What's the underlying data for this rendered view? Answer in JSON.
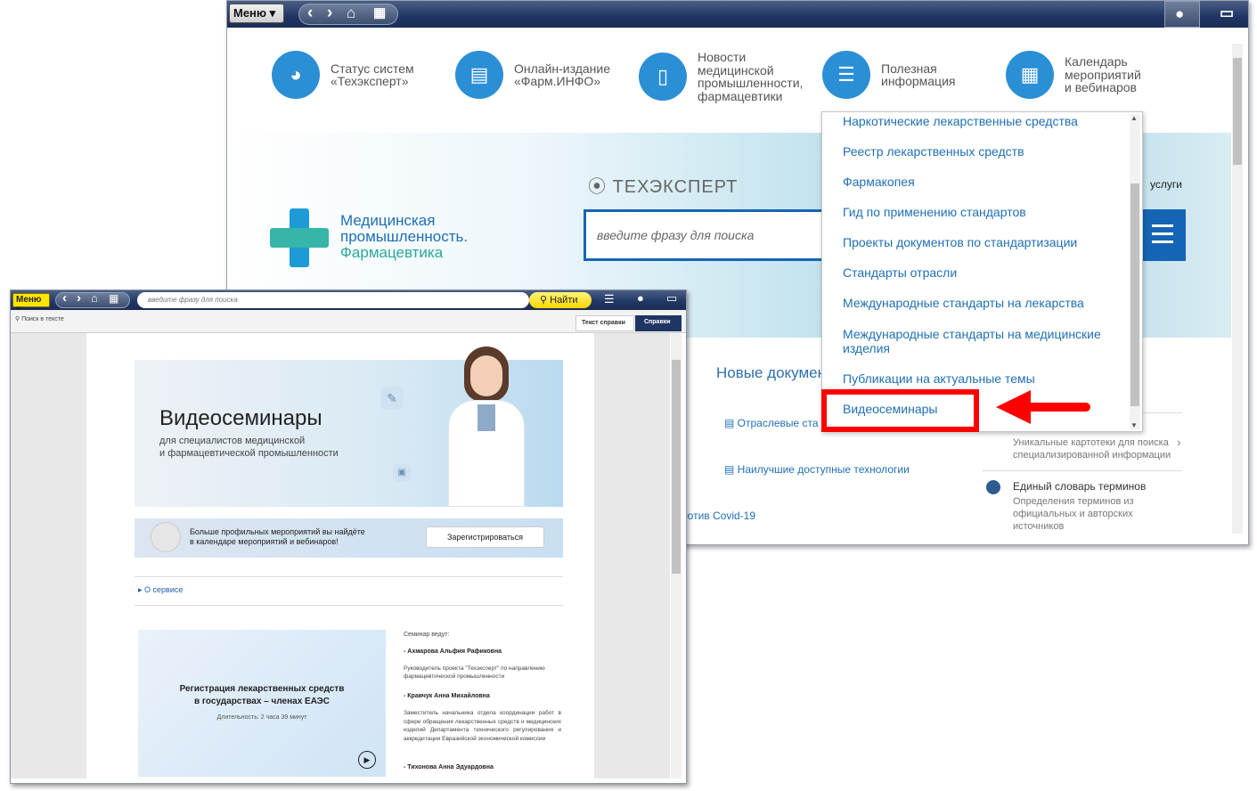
{
  "main_window": {
    "menu_label": "Меню",
    "topics": [
      {
        "icon": "rs-logo-icon",
        "label": "Статус систем\n«Техэксперт»"
      },
      {
        "icon": "monitor-icon",
        "label": "Онлайн-издание\n«Фарм.ИНФО»"
      },
      {
        "icon": "document-icon",
        "label": "Новости\nмедицинской\nпромышленности,\nфармацевтики"
      },
      {
        "icon": "info-document-icon",
        "label": "Полезная\nинформация"
      },
      {
        "icon": "calendar-icon",
        "label": "Календарь\nмероприятий\nи вебинаров"
      }
    ],
    "logo_text": "Медицинская\nпромышленность.",
    "logo_text_accent": "Фармацевтика",
    "brand": "ТЕХЭКСПЕРТ",
    "search_placeholder": "введите фразу для поиска",
    "services_partial": "услуги",
    "new_docs_heading": "Новые документ",
    "links": [
      "Отраслевые ста",
      "Наилучшие доступные технологии",
      "ротив Covid-19"
    ],
    "right_items": [
      {
        "title": "",
        "desc": "Уникальные картотеки для поиска\nспециализированной информации"
      },
      {
        "title": "Единый словарь терминов",
        "desc": "Определения терминов из\nофициальных и авторских\nисточников"
      }
    ]
  },
  "dropdown": {
    "items": [
      "Наркотические лекарственные средства",
      "Реестр лекарственных средств",
      "Фармакопея",
      "Гид по применению стандартов",
      "Проекты документов по стандартизации",
      "Стандарты отрасли",
      "Международные стандарты на лекарства",
      "Международные стандарты на медицинские изделия",
      "Публикации на актуальные темы",
      "Видеосеминары"
    ],
    "highlight_color": "#ff0000"
  },
  "small_window": {
    "menu_label": "Меню",
    "search_placeholder": "введите фразу для поиска",
    "find_label": "Найти",
    "search_in_text": "Поиск в тексте",
    "tabs": [
      "Текст справки",
      "Справки"
    ],
    "hero_title": "Видеосеминары",
    "hero_subtitle": "для специалистов медицинской\nи фармацевтической промышленности",
    "promo_text": "Больше профильных мероприятий вы найдёте\nв календаре мероприятий и вебинаров!",
    "register_label": "Зарегистрироваться",
    "about_label": "О сервисе",
    "seminar_title": "Регистрация лекарственных средств\nв государствах – членах ЕАЭС",
    "seminar_duration": "Длительность: 2 часа 39 минут",
    "seminar_led": "Семинар ведут:",
    "speakers": [
      {
        "name": "- Ахмарова Альфия Рафиковна",
        "role": "Руководитель проекта \"Техэксперт\" по направлению фармацевтической промышленности"
      },
      {
        "name": "- Кравчук Анна Михайловна",
        "role": "Заместитель начальника отдела координации работ в сфере обращения лекарственных средств и медицинских изделий Департамента технического регулирования и аккредитации Евразийской экономической комиссии"
      },
      {
        "name": "- Тихонова Анна Эдуардовна",
        "role": ""
      }
    ]
  }
}
